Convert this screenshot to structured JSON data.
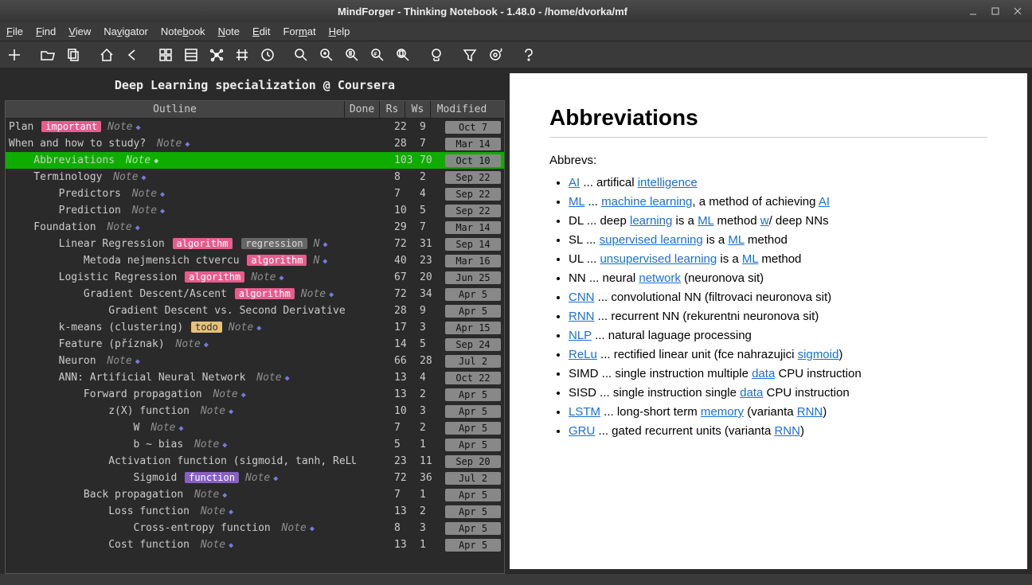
{
  "window": {
    "title": "MindForger - Thinking Notebook - 1.48.0 - /home/dvorka/mf"
  },
  "menu": [
    "File",
    "Find",
    "View",
    "Navigator",
    "Notebook",
    "Note",
    "Edit",
    "Format",
    "Help"
  ],
  "menu_u": [
    0,
    0,
    0,
    2,
    4,
    0,
    0,
    3,
    0
  ],
  "notebook_title": "Deep Learning specialization @ Coursera",
  "columns": {
    "outline": "Outline",
    "done": "Done",
    "rs": "Rs",
    "ws": "Ws",
    "modified": "Modified"
  },
  "rows": [
    {
      "indent": 0,
      "title": "Plan",
      "tags": [
        {
          "t": "important",
          "c": "important"
        }
      ],
      "type": "Note",
      "rs": "22",
      "ws": "9",
      "mod": "Oct  7"
    },
    {
      "indent": 0,
      "title": "When and how to study?",
      "tags": [],
      "type": "Note",
      "rs": "28",
      "ws": "7",
      "mod": "Mar 14"
    },
    {
      "indent": 1,
      "title": "Abbreviations",
      "tags": [],
      "type": "Note",
      "rs": "103",
      "ws": "70",
      "mod": "Oct 10",
      "selected": true
    },
    {
      "indent": 1,
      "title": "Terminology",
      "tags": [],
      "type": "Note",
      "rs": "8",
      "ws": "2",
      "mod": "Sep 22"
    },
    {
      "indent": 2,
      "title": "Predictors",
      "tags": [],
      "type": "Note",
      "rs": "7",
      "ws": "4",
      "mod": "Sep 22"
    },
    {
      "indent": 2,
      "title": "Prediction",
      "tags": [],
      "type": "Note",
      "rs": "10",
      "ws": "5",
      "mod": "Sep 22"
    },
    {
      "indent": 1,
      "title": "Foundation",
      "tags": [],
      "type": "Note",
      "rs": "29",
      "ws": "7",
      "mod": "Mar 14"
    },
    {
      "indent": 2,
      "title": "Linear Regression",
      "tags": [
        {
          "t": "algorithm",
          "c": "algorithm"
        },
        {
          "t": "regression",
          "c": "regression"
        }
      ],
      "type": "N",
      "rs": "72",
      "ws": "31",
      "mod": "Sep 14"
    },
    {
      "indent": 3,
      "title": "Metoda nejmensich ctvercu",
      "tags": [
        {
          "t": "algorithm",
          "c": "algorithm"
        }
      ],
      "type": "N",
      "rs": "40",
      "ws": "23",
      "mod": "Mar 16"
    },
    {
      "indent": 2,
      "title": "Logistic Regression",
      "tags": [
        {
          "t": "algorithm",
          "c": "algorithm"
        }
      ],
      "type": "Note",
      "rs": "67",
      "ws": "20",
      "mod": "Jun 25"
    },
    {
      "indent": 3,
      "title": "Gradient Descent/Ascent",
      "tags": [
        {
          "t": "algorithm",
          "c": "algorithm"
        }
      ],
      "type": "Note",
      "rs": "72",
      "ws": "34",
      "mod": "Apr  5"
    },
    {
      "indent": 4,
      "title": "Gradient Descent vs. Second Derivative",
      "tags": [],
      "type": "",
      "rs": "28",
      "ws": "9",
      "mod": "Apr  5"
    },
    {
      "indent": 2,
      "title": "k-means (clustering)",
      "tags": [
        {
          "t": "todo",
          "c": "todo"
        }
      ],
      "type": "Note",
      "rs": "17",
      "ws": "3",
      "mod": "Apr 15"
    },
    {
      "indent": 2,
      "title": "Feature (příznak)",
      "tags": [],
      "type": "Note",
      "rs": "14",
      "ws": "5",
      "mod": "Sep 24"
    },
    {
      "indent": 2,
      "title": "Neuron",
      "tags": [],
      "type": "Note",
      "rs": "66",
      "ws": "28",
      "mod": "Jul  2"
    },
    {
      "indent": 2,
      "title": "ANN: Artificial Neural Network",
      "tags": [],
      "type": "Note",
      "rs": "13",
      "ws": "4",
      "mod": "Oct 22"
    },
    {
      "indent": 3,
      "title": "Forward propagation",
      "tags": [],
      "type": "Note",
      "rs": "13",
      "ws": "2",
      "mod": "Apr  5"
    },
    {
      "indent": 4,
      "title": "z(X) function",
      "tags": [],
      "type": "Note",
      "rs": "10",
      "ws": "3",
      "mod": "Apr  5"
    },
    {
      "indent": 5,
      "title": "W",
      "tags": [],
      "type": "Note",
      "rs": "7",
      "ws": "2",
      "mod": "Apr  5"
    },
    {
      "indent": 5,
      "title": "b ~ bias",
      "tags": [],
      "type": "Note",
      "rs": "5",
      "ws": "1",
      "mod": "Apr  5"
    },
    {
      "indent": 4,
      "title": "Activation function (sigmoid, tanh, ReLU",
      "tags": [],
      "type": "",
      "rs": "23",
      "ws": "11",
      "mod": "Sep 20"
    },
    {
      "indent": 5,
      "title": "Sigmoid",
      "tags": [
        {
          "t": "function",
          "c": "function"
        }
      ],
      "type": "Note",
      "rs": "72",
      "ws": "36",
      "mod": "Jul  2"
    },
    {
      "indent": 3,
      "title": "Back propagation",
      "tags": [],
      "type": "Note",
      "rs": "7",
      "ws": "1",
      "mod": "Apr  5"
    },
    {
      "indent": 4,
      "title": "Loss function",
      "tags": [],
      "type": "Note",
      "rs": "13",
      "ws": "2",
      "mod": "Apr  5"
    },
    {
      "indent": 5,
      "title": "Cross-entropy function",
      "tags": [],
      "type": "Note",
      "rs": "8",
      "ws": "3",
      "mod": "Apr  5"
    },
    {
      "indent": 4,
      "title": "Cost function",
      "tags": [],
      "type": "Note",
      "rs": "13",
      "ws": "1",
      "mod": "Apr  5"
    }
  ],
  "content": {
    "heading": "Abbreviations",
    "intro": "Abbrevs:",
    "items": [
      {
        "pre": "",
        "link": "AI",
        "mid": " ... artifical ",
        "link2": "intelligence",
        "post": ""
      },
      {
        "pre": "",
        "link": "ML",
        "mid": " ... ",
        "link2": "machine learning",
        "post": ", a method of achieving ",
        "link3": "AI"
      },
      {
        "plain": "DL ... deep ",
        "link": "learning",
        "mid": " is a ",
        "link2": "ML",
        "post": " method ",
        "link3": "w",
        "post2": "/ deep NNs"
      },
      {
        "plain": "SL ... ",
        "link": "supervised learning",
        "mid": " is a ",
        "link2": "ML",
        "post": " method"
      },
      {
        "plain": "UL ... ",
        "link": "unsupervised learning",
        "mid": " is a ",
        "link2": "ML",
        "post": " method"
      },
      {
        "plain": "NN ... neural ",
        "link": "network",
        "post": " (neuronova sit)"
      },
      {
        "pre": "",
        "link": "CNN",
        "post": " ... convolutional NN (filtrovaci neuronova sit)"
      },
      {
        "pre": "",
        "link": "RNN",
        "post": " ... recurrent NN (rekurentni neuronova sit)"
      },
      {
        "pre": "",
        "link": "NLP",
        "post": " ... natural laguage processing"
      },
      {
        "pre": "",
        "link": "ReLu",
        "mid": " ... rectified linear unit (fce nahrazujici ",
        "link2": "sigmoid",
        "post": ")"
      },
      {
        "plain": "SIMD ... single instruction multiple ",
        "link": "data",
        "post": " CPU instruction"
      },
      {
        "plain": "SISD ... single instruction single ",
        "link": "data",
        "post": " CPU instruction"
      },
      {
        "pre": "",
        "link": "LSTM",
        "mid": " ... long-short term ",
        "link2": "memory",
        "post": " (varianta ",
        "link3": "RNN",
        "post2": ")"
      },
      {
        "pre": "",
        "link": "GRU",
        "mid": " ... gated recurrent units (varianta ",
        "link2": "RNN",
        "post": ")"
      }
    ]
  }
}
